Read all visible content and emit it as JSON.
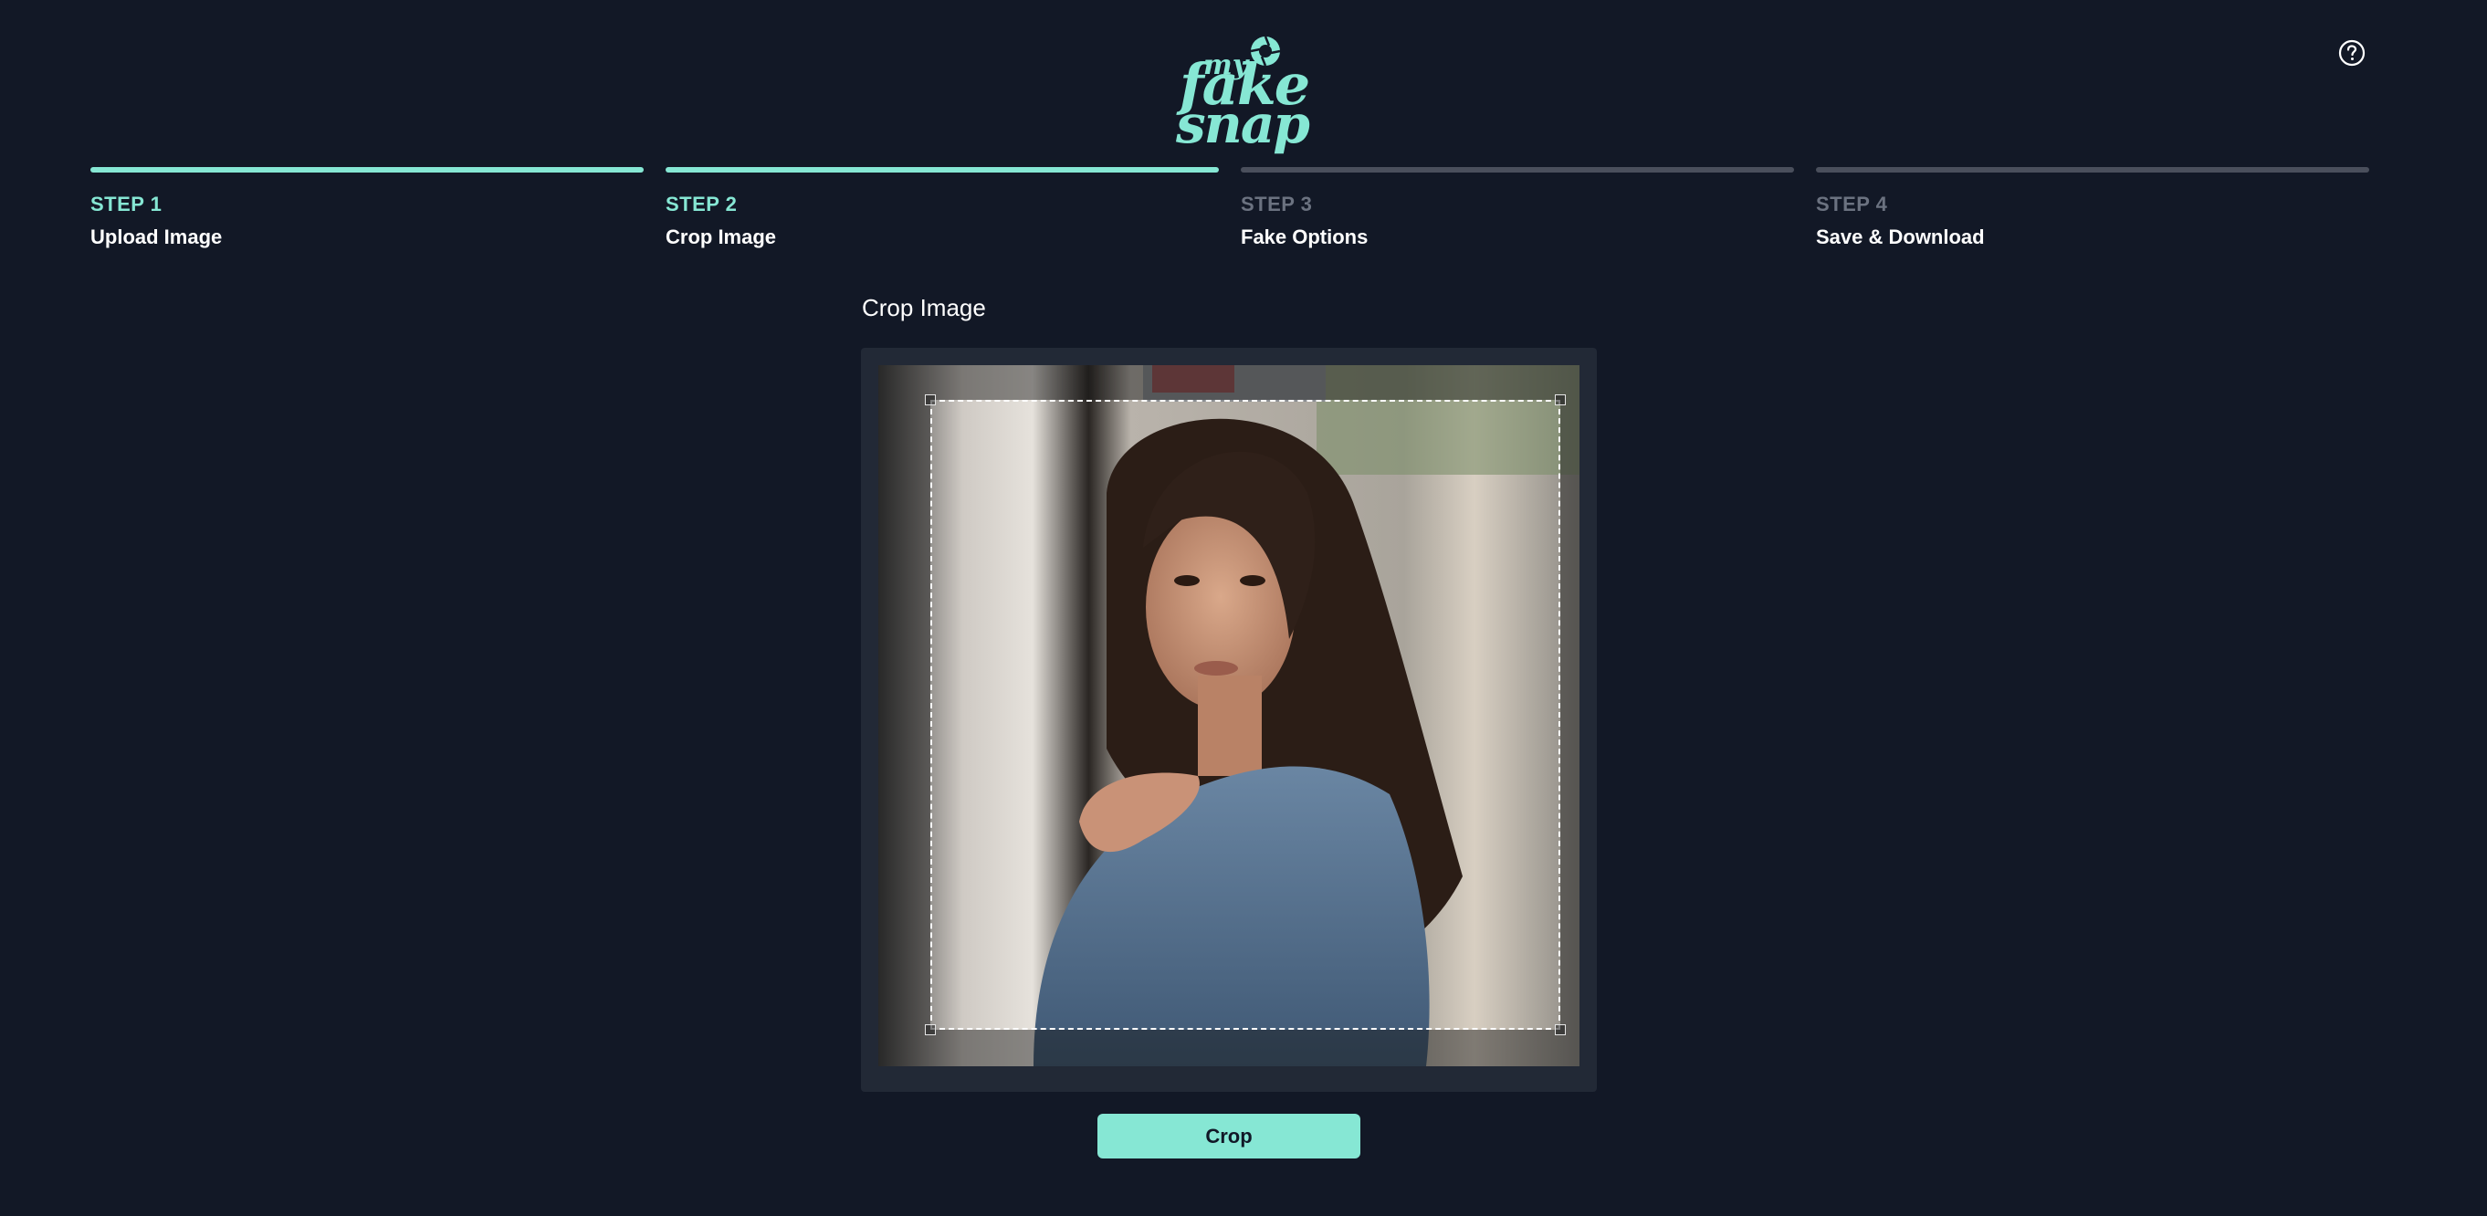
{
  "logo": {
    "line1": "my",
    "line2": "fake",
    "line3": "snap",
    "icon": "camera-shutter-icon"
  },
  "help": {
    "icon": "help-circle-icon"
  },
  "steps": [
    {
      "number": "STEP 1",
      "title": "Upload Image",
      "active": true
    },
    {
      "number": "STEP 2",
      "title": "Crop Image",
      "active": true
    },
    {
      "number": "STEP 3",
      "title": "Fake Options",
      "active": false
    },
    {
      "number": "STEP 4",
      "title": "Save & Download",
      "active": false
    }
  ],
  "crop": {
    "heading": "Crop Image",
    "button_label": "Crop"
  },
  "colors": {
    "background": "#121826",
    "accent": "#86e7d4",
    "inactive_bar": "#4a4f5c",
    "frame": "#222936"
  }
}
